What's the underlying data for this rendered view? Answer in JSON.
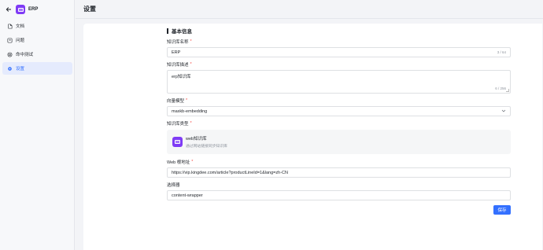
{
  "sidebar": {
    "app_name": "ERP",
    "items": [
      {
        "label": "文档",
        "icon": "document-icon"
      },
      {
        "label": "问题",
        "icon": "question-icon"
      },
      {
        "label": "命中测试",
        "icon": "target-icon"
      },
      {
        "label": "设置",
        "icon": "gear-icon"
      }
    ],
    "active_index": 3
  },
  "header": {
    "title": "设置"
  },
  "form": {
    "section_title": "基本信息",
    "kb_name": {
      "label": "知识库名称",
      "required": "*",
      "value": "ERP",
      "count": "3 / 64"
    },
    "kb_desc": {
      "label": "知识库描述",
      "required": "*",
      "value": "erp知识库",
      "count": "6 / 256"
    },
    "vector_model": {
      "label": "向量模型",
      "required": "*",
      "value": "maxkb-embedding"
    },
    "kb_type": {
      "label": "知识库类型",
      "required": "*",
      "title": "web知识库",
      "desc": "通过网站链接同步知识库"
    },
    "web_url": {
      "label": "Web 根地址",
      "required": "*",
      "value": "https://vip.kingdee.com/article?productLineId=1&lang=zh-CN"
    },
    "selector": {
      "label": "选择器",
      "value": "content-wrapper"
    },
    "save_label": "保存"
  },
  "colors": {
    "accent": "#3370ff",
    "brand": "#7f3bf5",
    "required": "#f54a45"
  }
}
